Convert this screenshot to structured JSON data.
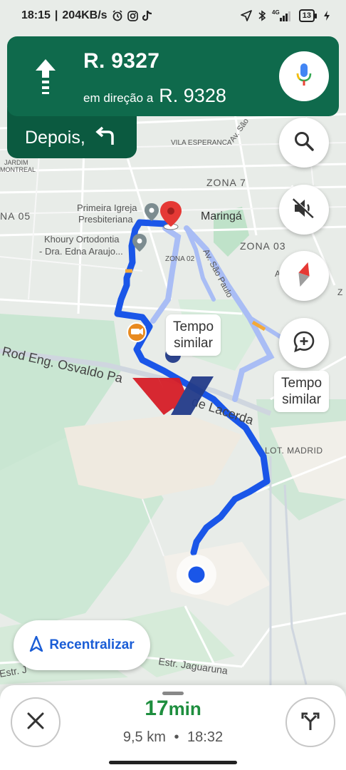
{
  "status_bar": {
    "time": "18:15",
    "data_speed": "204KB/s",
    "network": "4G",
    "battery": "13",
    "icons": [
      "alarm-icon",
      "instagram-icon",
      "tiktok-icon",
      "location-icon",
      "bluetooth-icon",
      "signal-icon",
      "charging-icon"
    ]
  },
  "navigation": {
    "street": "R. 9327",
    "toward_label": "em direção a",
    "toward_street": "R. 9328",
    "then_label": "Depois,",
    "maneuver_icon": "straight-arrow-icon",
    "then_icon": "turn-left-icon",
    "colors": {
      "primary": "#0f6a4c",
      "secondary": "#0b5a40"
    }
  },
  "map": {
    "labels": {
      "vila_esperanca": "VILA ESPERANCA",
      "av_sao": "Av. São",
      "jardim": "JARDIM",
      "montreal": "MONTREAL",
      "zona7": "ZONA 7",
      "zona05": "NA 05",
      "maringa": "Maringá",
      "zona03": "ZONA 03",
      "zona02": "ZONA 02",
      "primeira_igreja_1": "Primeira Igreja",
      "primeira_igreja_2": "Presbiteriana",
      "khoury_1": "Khoury Ortodontia",
      "khoury_2": "- Dra. Edna Araujo...",
      "av_sao_paulo": "Av. São Paulo",
      "rod": "Rod Eng. Osvaldo Pa",
      "lacerda": "de Lacerda",
      "lot_madrid": "LOT. MADRID",
      "estr_left": "Estr. J",
      "estr_jaguaruna": "Estr. Jaguaruna",
      "a_right": "A",
      "z_right": "Z"
    },
    "route_color": "#1a56e8",
    "alt_route_color": "#a9bdf5"
  },
  "alternates": [
    {
      "line1": "Tempo",
      "line2": "similar"
    },
    {
      "line1": "Tempo",
      "line2": "similar"
    }
  ],
  "side_buttons": [
    "search-icon",
    "mute-icon",
    "compass-icon",
    "add-comment-icon"
  ],
  "recenter_label": "Recentralizar",
  "trip": {
    "duration_value": "17",
    "duration_unit": "min",
    "distance": "9,5 km",
    "separator": "•",
    "arrival": "18:32"
  },
  "colors": {
    "eta_green": "#1e8e3e",
    "recenter_blue": "#1a5dd6",
    "destination_red": "#e53935"
  }
}
